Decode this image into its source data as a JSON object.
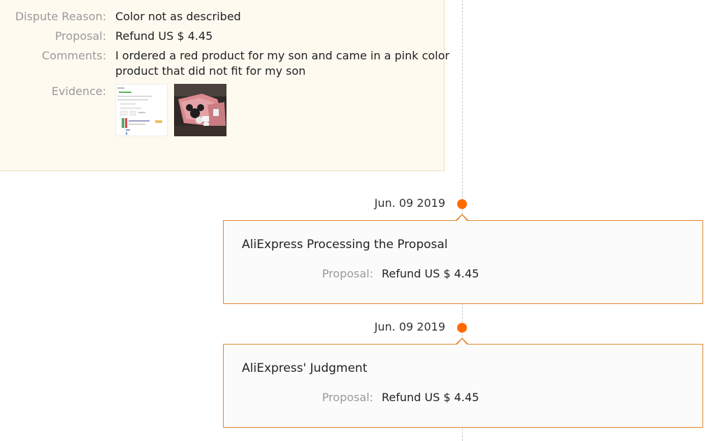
{
  "dispute": {
    "reason_label": "Dispute Reason:",
    "reason_value": "Color not as described",
    "proposal_label": "Proposal:",
    "proposal_value": "Refund US $ 4.45",
    "comments_label": "Comments:",
    "comments_line1": "I ordered a red product for my son and came in a pink color",
    "comments_line2": "product that did not fit for my son",
    "evidence_label": "Evidence:",
    "evidence_images": [
      "screenshot-thumbnail",
      "product-photo-thumbnail"
    ]
  },
  "timeline": [
    {
      "date": "Jun. 09 2019",
      "title": "AliExpress Processing the Proposal",
      "proposal_label": "Proposal:",
      "proposal_value": "Refund US $ 4.45"
    },
    {
      "date": "Jun. 09 2019",
      "title": "AliExpress' Judgment",
      "proposal_label": "Proposal:",
      "proposal_value": "Refund US $ 4.45"
    }
  ],
  "colors": {
    "accent": "#ff6a00",
    "card_border": "#e08a2e",
    "top_card_bg": "#fffaf0",
    "label": "#9a9a9a"
  }
}
